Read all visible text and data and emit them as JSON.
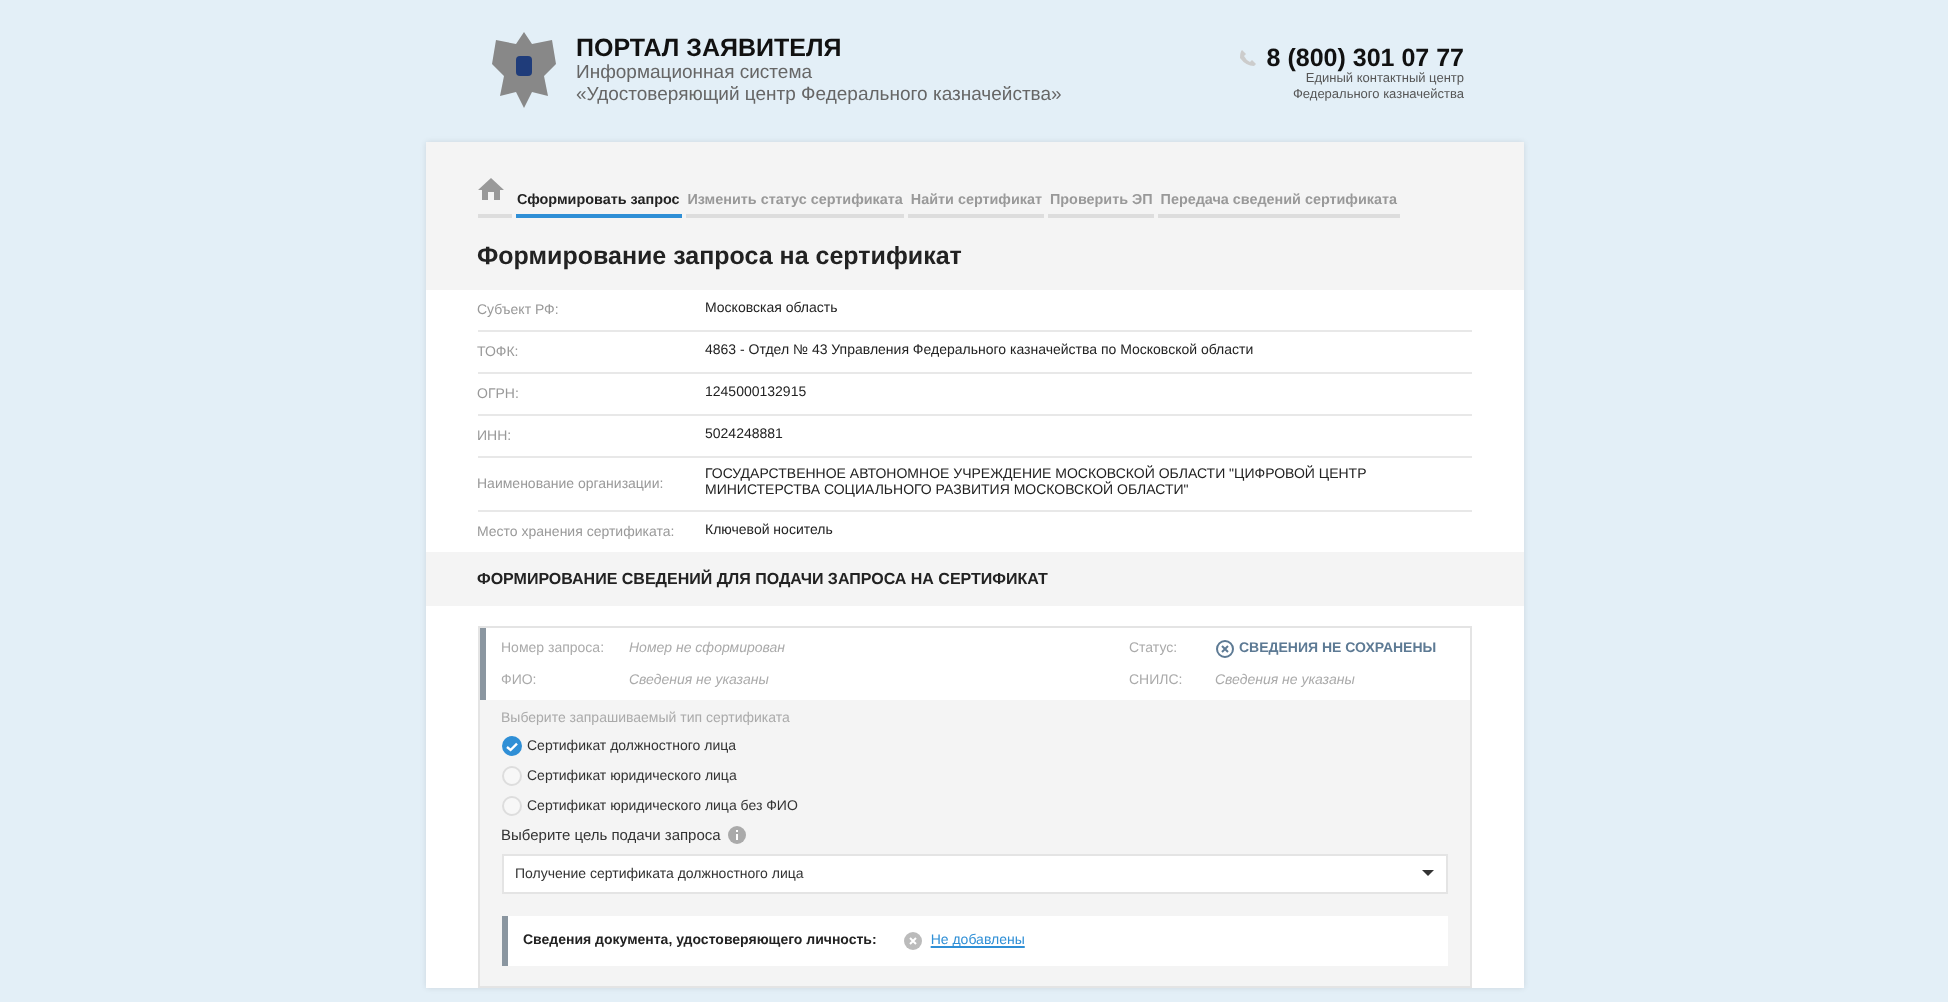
{
  "header": {
    "title": "ПОРТАЛ ЗАЯВИТЕЛЯ",
    "subtitle_1": "Информационная система",
    "subtitle_2": "«Удостоверяющий центр Федерального казначейства»",
    "phone": "8 (800) 301 07 77",
    "phone_caption_1": "Единый контактный центр",
    "phone_caption_2": "Федерального казначейства"
  },
  "tabs": [
    {
      "label": "Сформировать запрос",
      "selected": true
    },
    {
      "label": "Изменить статус сертификата",
      "selected": false
    },
    {
      "label": "Найти сертификат",
      "selected": false
    },
    {
      "label": "Проверить ЭП",
      "selected": false
    },
    {
      "label": "Передача сведений сертификата",
      "selected": false
    }
  ],
  "page_title": "Формирование запроса на сертификат",
  "info_rows": [
    {
      "label": "Субъект РФ:",
      "value": "Московская область"
    },
    {
      "label": "ТОФК:",
      "value": "4863 - Отдел № 43 Управления Федерального казначейства по Московской области"
    },
    {
      "label": "ОГРН:",
      "value": "1245000132915"
    },
    {
      "label": "ИНН:",
      "value": "5024248881"
    },
    {
      "label": "Наименование организации:",
      "value": "ГОСУДАРСТВЕННОЕ АВТОНОМНОЕ УЧРЕЖДЕНИЕ МОСКОВСКОЙ ОБЛАСТИ \"ЦИФРОВОЙ ЦЕНТР МИНИСТЕРСТВА СОЦИАЛЬНОГО РАЗВИТИЯ МОСКОВСКОЙ ОБЛАСТИ\""
    },
    {
      "label": "Место хранения сертификата:",
      "value": "Ключевой носитель"
    }
  ],
  "section_title": "ФОРМИРОВАНИЕ СВЕДЕНИЙ ДЛЯ ПОДАЧИ ЗАПРОСА НА СЕРТИФИКАТ",
  "request": {
    "number_label": "Номер запроса:",
    "number_value": "Номер не сформирован",
    "status_label": "Статус:",
    "status_value": "СВЕДЕНИЯ НЕ СОХРАНЕНЫ",
    "fio_label": "ФИО:",
    "fio_value": "Сведения не указаны",
    "snils_label": "СНИЛС:",
    "snils_value": "Сведения не указаны"
  },
  "cert_type_label": "Выберите запрашиваемый тип сертификата",
  "cert_types": [
    {
      "label": "Сертификат должностного лица",
      "selected": true
    },
    {
      "label": "Сертификат юридического лица",
      "selected": false
    },
    {
      "label": "Сертификат юридического лица без ФИО",
      "selected": false
    }
  ],
  "purpose_label": "Выберите цель подачи запроса",
  "purpose_value": "Получение сертификата должностного лица",
  "document": {
    "label": "Сведения документа, удостоверяющего личность:",
    "link": "Не добавлены"
  }
}
